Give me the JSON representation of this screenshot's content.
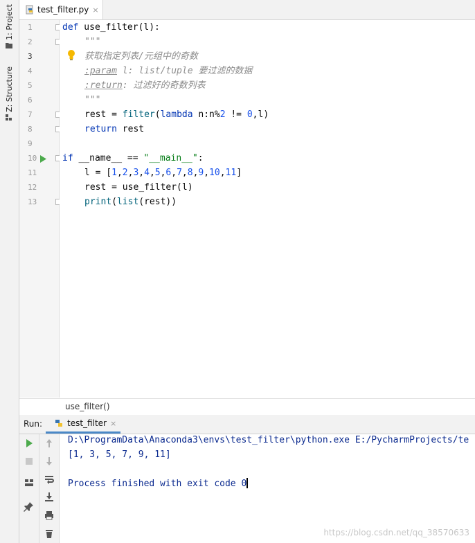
{
  "sidebar": {
    "project_label": "1: Project",
    "structure_label": "Z: Structure"
  },
  "editor": {
    "tab_label": "test_filter.py",
    "tab_close": "×",
    "line_numbers": [
      "1",
      "2",
      "3",
      "4",
      "5",
      "6",
      "7",
      "8",
      "9",
      "10",
      "11",
      "12",
      "13"
    ],
    "lines": {
      "l1_def": "def",
      "l1_rest": " use_filter(l):",
      "l2": "\"\"\"",
      "l3": "获取指定列表/元组中的奇数",
      "l4_tag": ":param",
      "l4_rest": " l: list/tuple 要过滤的数据",
      "l5_tag": ":return",
      "l5_rest": ": 过滤好的奇数列表",
      "l6": "\"\"\"",
      "l7_a": "rest = ",
      "l7_filter": "filter",
      "l7_b": "(",
      "l7_lambda": "lambda",
      "l7_c": " n:n%",
      "l7_2": "2",
      "l7_d": " != ",
      "l7_0": "0",
      "l7_e": ",l)",
      "l8_kw": "return",
      "l8_rest": " rest",
      "l10_if": "if",
      "l10_a": " __name__ == ",
      "l10_str": "\"__main__\"",
      "l10_b": ":",
      "l11_a": "l = [",
      "l11_nums": [
        "1",
        "2",
        "3",
        "4",
        "5",
        "6",
        "7",
        "8",
        "9",
        "10",
        "11"
      ],
      "l11_b": "]",
      "l12": "rest = use_filter(l)",
      "l13_print": "print",
      "l13_a": "(",
      "l13_list": "list",
      "l13_b": "(rest))"
    }
  },
  "breadcrumb": "use_filter()",
  "run": {
    "label": "Run:",
    "tab_label": "test_filter",
    "tab_close": "×",
    "console": [
      "D:\\ProgramData\\Anaconda3\\envs\\test_filter\\python.exe E:/PycharmProjects/te",
      "[1, 3, 5, 7, 9, 11]",
      "",
      "Process finished with exit code 0"
    ]
  },
  "watermark": "https://blog.csdn.net/qq_38570633",
  "colors": {
    "keyword": "#0033b3",
    "builtin": "#00627a",
    "number": "#1750eb",
    "string": "#067d17",
    "docstring": "#8c8c8c",
    "console_text": "#0b2a8f",
    "run_green": "#4caa4c"
  },
  "icons": {
    "run": "play-icon",
    "stop": "stop-icon",
    "bulb": "lightbulb-icon",
    "python": "python-file-icon"
  }
}
